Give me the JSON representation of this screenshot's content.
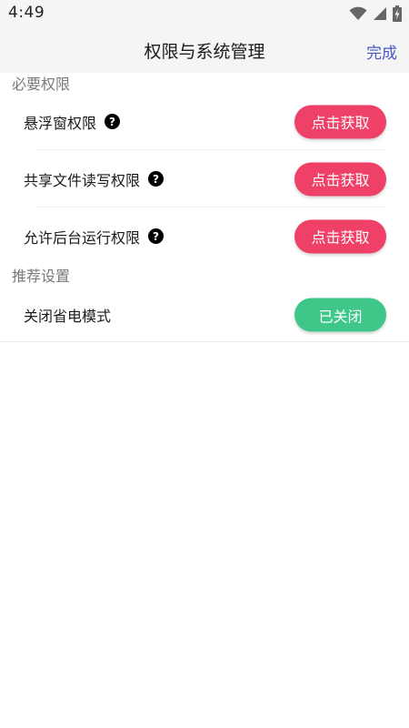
{
  "status_bar": {
    "time": "4:49",
    "icons": [
      "wifi-icon",
      "signal-icon",
      "battery-charging-icon"
    ]
  },
  "app_bar": {
    "title": "权限与系统管理",
    "done_label": "完成",
    "done_color": "#4a57c6"
  },
  "sections": {
    "required": {
      "header": "必要权限",
      "items": [
        {
          "label": "悬浮窗权限",
          "button": "点击获取"
        },
        {
          "label": "共享文件读写权限",
          "button": "点击获取"
        },
        {
          "label": "允许后台运行权限",
          "button": "点击获取"
        }
      ]
    },
    "recommended": {
      "header": "推荐设置",
      "items": [
        {
          "label": "关闭省电模式",
          "button": "已关闭"
        }
      ]
    }
  },
  "colors": {
    "action_red": "#ef4068",
    "action_green": "#3fc78a"
  }
}
